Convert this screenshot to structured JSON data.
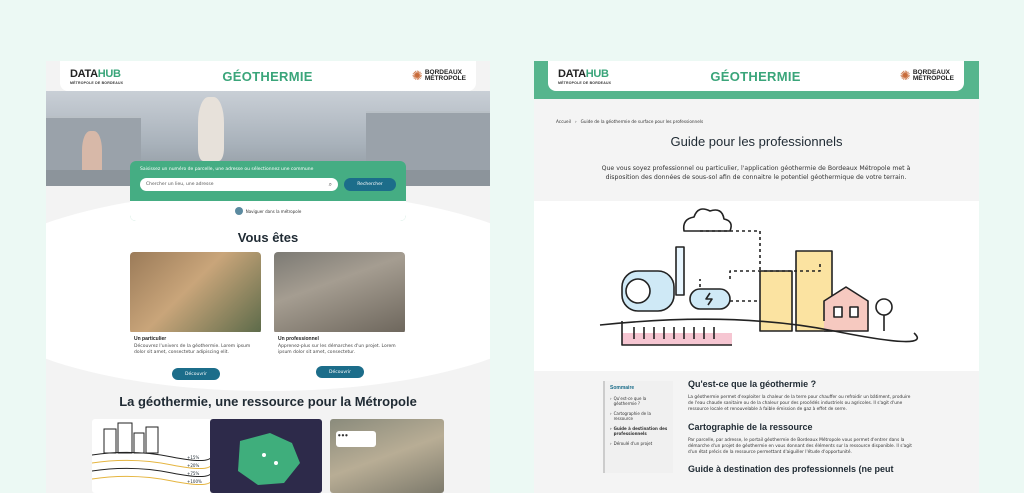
{
  "left": {
    "header": {
      "logo_main": "DATA",
      "logo_accent": "HUB",
      "logo_sub": "MÉTROPOLE DE BORDEAUX",
      "title": "GÉOTHERMIE",
      "partner_line1": "BORDEAUX",
      "partner_line2": "MÉTROPOLE"
    },
    "search": {
      "prompt": "Saisissez un numéro de parcelle, une adresse ou sélectionnez une commune",
      "placeholder": "Chercher un lieu, une adresse",
      "button": "Rechercher",
      "nav_link": "Naviguer dans la métropole"
    },
    "audience": {
      "heading": "Vous êtes",
      "cards": [
        {
          "label": "Un particulier",
          "text": "Découvrez l'univers de la géothermie. Lorem ipsum dolor sit amet, consectetur adipiscing elit.",
          "button": "Découvrir"
        },
        {
          "label": "Un professionnel",
          "text": "Apprenez-plus sur les démarches d'un projet. Lorem ipsum dolor sit amet, consectetur.",
          "button": "Découvrir"
        }
      ]
    },
    "resource_heading": "La géothermie, une ressource pour la Métropole",
    "tile_labels": [
      "+15%",
      "+20%",
      "+75%",
      "+100%"
    ]
  },
  "right": {
    "header": {
      "logo_main": "DATA",
      "logo_accent": "HUB",
      "logo_sub": "MÉTROPOLE DE BORDEAUX",
      "title": "GÉOTHERMIE",
      "partner_line1": "BORDEAUX",
      "partner_line2": "MÉTROPOLE"
    },
    "breadcrumb": [
      "Accueil",
      "Guide de la géothermie de surface pour les professionnels"
    ],
    "title": "Guide pour les professionnels",
    "intro": "Que vous soyez professionnel ou particulier, l'application géothermie de Bordeaux Métropole met à disposition des données de sous-sol afin de connaitre le potentiel géothermique de votre terrain.",
    "sommaire": {
      "title": "Sommaire",
      "items": [
        "Qu'est-ce que la géothermie ?",
        "Cartographie de la ressource",
        "Guide à destination des professionnels",
        "Déroulé d'un projet"
      ]
    },
    "sections": [
      {
        "heading": "Qu'est-ce que la géothermie ?",
        "text": "La géothermie permet d'exploiter la chaleur de la terre pour chauffer ou refroidir un bâtiment, produire de l'eau chaude sanitaire ou de la chaleur pour des procédés industriels ou agricoles. Il s'agit d'une ressource locale et renouvelable à faible émission de gaz à effet de serre."
      },
      {
        "heading": "Cartographie de la ressource",
        "text": "Par parcelle, par adresse, le portail géothermie de Bordeaux Métropole vous permet d'entrer dans la démarche d'un projet de géothermie en vous donnant des éléments sur la ressource disponible. Il s'agit d'un état précis de la ressource permettant d'aiguiller l'étude d'opportunité."
      },
      {
        "heading": "Guide à destination des professionnels (ne peut"
      }
    ]
  }
}
